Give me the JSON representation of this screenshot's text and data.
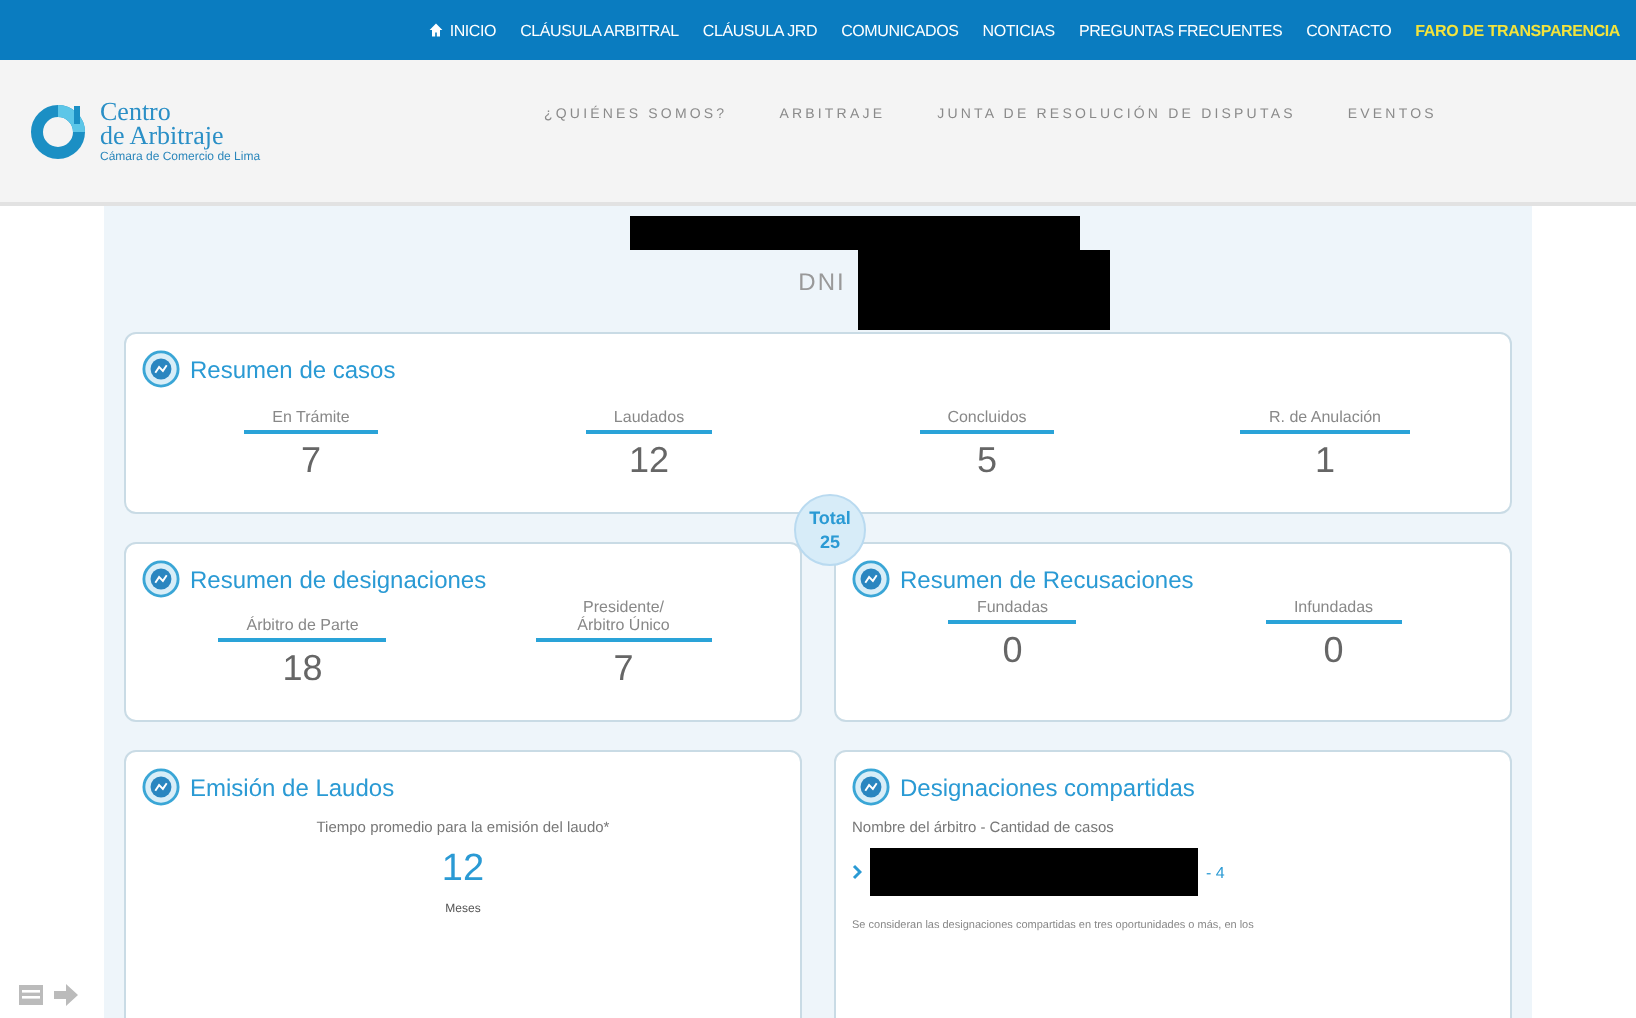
{
  "top_nav": [
    {
      "label": "INICIO",
      "kind": "home"
    },
    {
      "label": "CLÁUSULA ARBITRAL",
      "kind": "link"
    },
    {
      "label": "CLÁUSULA JRD",
      "kind": "link"
    },
    {
      "label": "COMUNICADOS",
      "kind": "link"
    },
    {
      "label": "NOTICIAS",
      "kind": "link"
    },
    {
      "label": "PREGUNTAS FRECUENTES",
      "kind": "link"
    },
    {
      "label": "CONTACTO",
      "kind": "link"
    },
    {
      "label": "FARO DE TRANSPARENCIA",
      "kind": "highlight"
    }
  ],
  "logo": {
    "line1": "Centro",
    "line2": "de Arbitraje",
    "subtitle": "Cámara de Comercio de Lima"
  },
  "main_nav": [
    "¿QUIÉNES SOMOS?",
    "ARBITRAJE",
    "JUNTA DE RESOLUCIÓN DE DISPUTAS",
    "EVENTOS"
  ],
  "profile": {
    "id_label": "DNI"
  },
  "cases": {
    "title": "Resumen de casos",
    "stats": [
      {
        "label": "En Trámite",
        "value": "7"
      },
      {
        "label": "Laudados",
        "value": "12"
      },
      {
        "label": "Concluidos",
        "value": "5"
      },
      {
        "label": "R. de Anulación",
        "value": "1"
      }
    ],
    "total_label": "Total",
    "total_value": "25"
  },
  "designations": {
    "title": "Resumen de designaciones",
    "stats": [
      {
        "label": "Árbitro de Parte",
        "value": "18"
      },
      {
        "label": "Presidente/ Árbitro Único",
        "value": "7"
      }
    ]
  },
  "recusals": {
    "title": "Resumen de Recusaciones",
    "stats": [
      {
        "label": "Fundadas",
        "value": "0"
      },
      {
        "label": "Infundadas",
        "value": "0"
      }
    ]
  },
  "awards": {
    "title": "Emisión de Laudos",
    "caption": "Tiempo promedio para la emisión del laudo*",
    "value": "12",
    "unit": "Meses"
  },
  "shared": {
    "title": "Designaciones compartidas",
    "header": "Nombre del árbitro - Cantidad de casos",
    "rows": [
      {
        "count": "- 4"
      }
    ],
    "note": "Se consideran las designaciones compartidas en tres oportunidades o más, en los"
  }
}
